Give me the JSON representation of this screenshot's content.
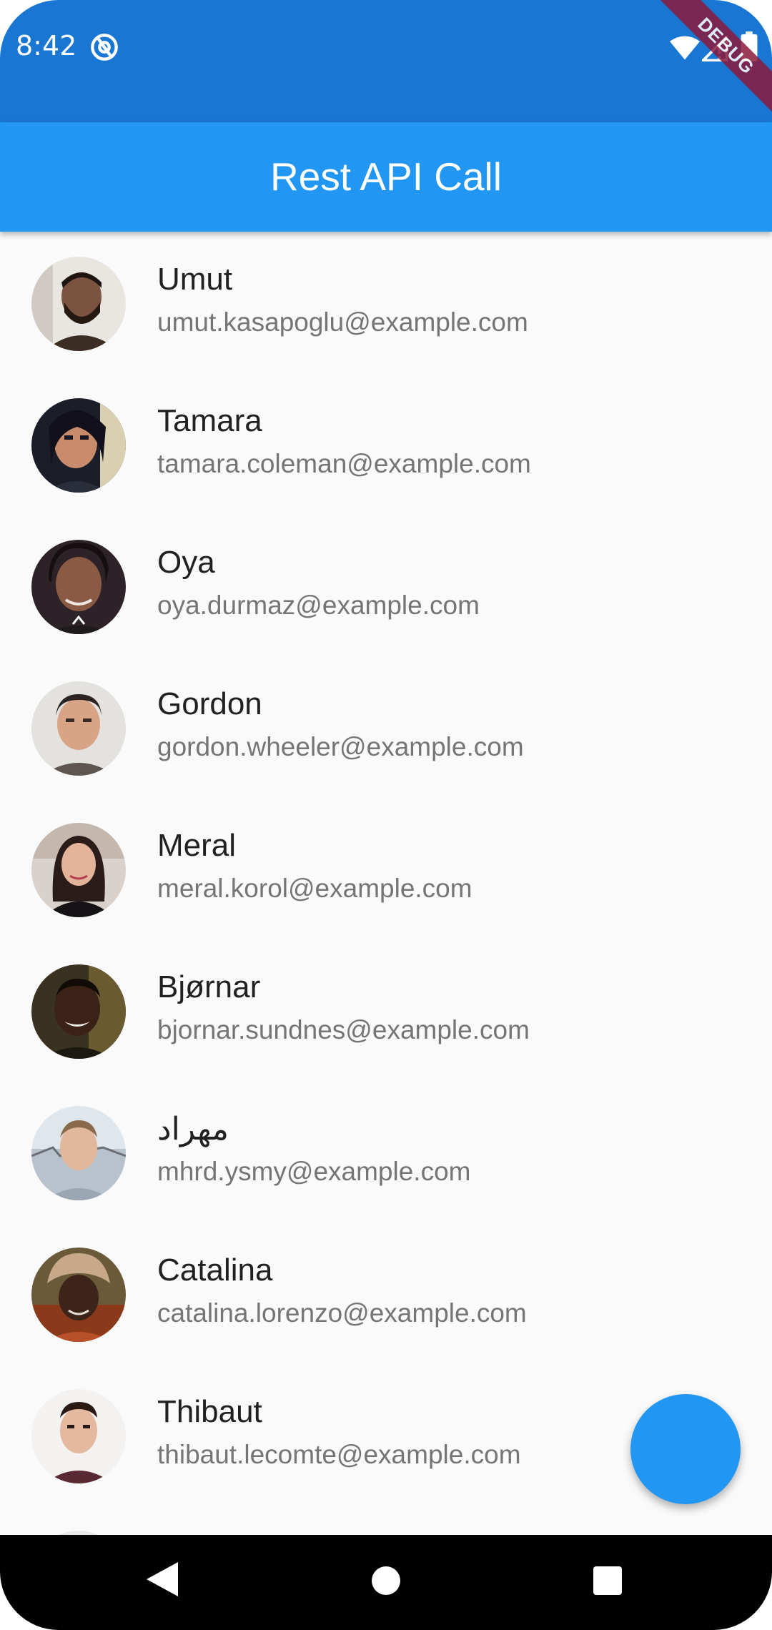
{
  "status_bar": {
    "time": "8:42",
    "notification_icon": "at-sign-icon",
    "icons": [
      "wifi-icon",
      "signal-icon",
      "battery-icon"
    ],
    "debug_banner": "DEBUG"
  },
  "app_bar": {
    "title": "Rest API Call",
    "color": "#2196f3"
  },
  "users": [
    {
      "name": "Umut",
      "email": "umut.kasapoglu@example.com",
      "avatar_icon": "user-avatar-icon"
    },
    {
      "name": "Tamara",
      "email": "tamara.coleman@example.com",
      "avatar_icon": "user-avatar-icon"
    },
    {
      "name": "Oya",
      "email": "oya.durmaz@example.com",
      "avatar_icon": "user-avatar-icon"
    },
    {
      "name": "Gordon",
      "email": "gordon.wheeler@example.com",
      "avatar_icon": "user-avatar-icon"
    },
    {
      "name": "Meral",
      "email": "meral.korol@example.com",
      "avatar_icon": "user-avatar-icon"
    },
    {
      "name": "Bjørnar",
      "email": "bjornar.sundnes@example.com",
      "avatar_icon": "user-avatar-icon"
    },
    {
      "name": "مهراد",
      "email": "mhrd.ysmy@example.com",
      "avatar_icon": "user-avatar-icon"
    },
    {
      "name": "Catalina",
      "email": "catalina.lorenzo@example.com",
      "avatar_icon": "user-avatar-icon"
    },
    {
      "name": "Thibaut",
      "email": "thibaut.lecomte@example.com",
      "avatar_icon": "user-avatar-icon"
    }
  ],
  "fab": {
    "icon": "none",
    "color": "#2196f3"
  },
  "nav_bar": {
    "back_icon": "back-triangle-icon",
    "home_icon": "home-circle-icon",
    "recents_icon": "recents-square-icon"
  },
  "colors": {
    "status_bar": "#1976d2",
    "primary": "#2196f3",
    "background": "#fafafa"
  }
}
